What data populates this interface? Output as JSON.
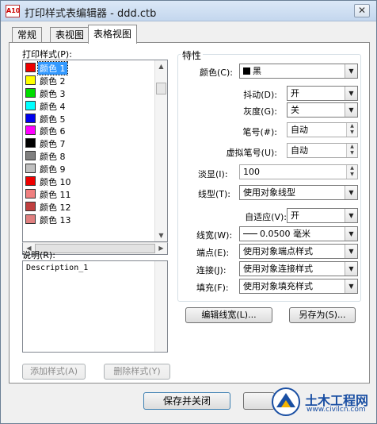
{
  "window": {
    "title": "打印样式表编辑器 - ddd.ctb",
    "close_symbol": "✕",
    "app_icon_text": "A10"
  },
  "tabs": [
    {
      "label": "常规"
    },
    {
      "label": "表视图"
    },
    {
      "label": "表格视图"
    }
  ],
  "styles_panel": {
    "label": "打印样式(P):",
    "items": [
      {
        "label": "颜色 1",
        "color": "#ee0000"
      },
      {
        "label": "颜色 2",
        "color": "#ffff00"
      },
      {
        "label": "颜色 3",
        "color": "#00dd00"
      },
      {
        "label": "颜色 4",
        "color": "#00ffff"
      },
      {
        "label": "颜色 5",
        "color": "#0000ee"
      },
      {
        "label": "颜色 6",
        "color": "#ff00ff"
      },
      {
        "label": "颜色 7",
        "color": "#000000"
      },
      {
        "label": "颜色 8",
        "color": "#808080"
      },
      {
        "label": "颜色 9",
        "color": "#c0c0c0"
      },
      {
        "label": "颜色 10",
        "color": "#ee0000"
      },
      {
        "label": "颜色 11",
        "color": "#f08080"
      },
      {
        "label": "颜色 12",
        "color": "#c04040"
      },
      {
        "label": "颜色 13",
        "color": "#e08080"
      }
    ],
    "selected_item": "颜色 1",
    "description_label": "说明(R):",
    "description_value": "Description_1",
    "add_style_button": "添加样式(A)",
    "delete_style_button": "删除样式(Y)"
  },
  "properties": {
    "group_title": "特性",
    "color_label": "颜色(C):",
    "color_value": "黑",
    "dither_label": "抖动(D):",
    "dither_value": "开",
    "grayscale_label": "灰度(G):",
    "grayscale_value": "关",
    "pen_label": "笔号(#):",
    "pen_value": "自动",
    "virtual_pen_label": "虚拟笔号(U):",
    "virtual_pen_value": "自动",
    "screening_label": "淡显(I):",
    "screening_value": "100",
    "linetype_label": "线型(T):",
    "linetype_value": "使用对象线型",
    "adaptive_label": "自适应(V):",
    "adaptive_value": "开",
    "lineweight_label": "线宽(W):",
    "lineweight_value": "0.0500 毫米",
    "endstyle_label": "端点(E):",
    "endstyle_value": "使用对象端点样式",
    "joinstyle_label": "连接(J):",
    "joinstyle_value": "使用对象连接样式",
    "fillstyle_label": "填充(F):",
    "fillstyle_value": "使用对象填充样式",
    "edit_lineweights_button": "编辑线宽(L)...",
    "save_as_button": "另存为(S)..."
  },
  "footer": {
    "save_close_button": "保存并关闭"
  },
  "watermark": {
    "title": "土木工程网",
    "url": "www.civilcn.com"
  },
  "colors": {
    "selection": "#3399ff",
    "title_bar": "#c4d7ee",
    "watermark_blue": "#1a4fa3"
  }
}
